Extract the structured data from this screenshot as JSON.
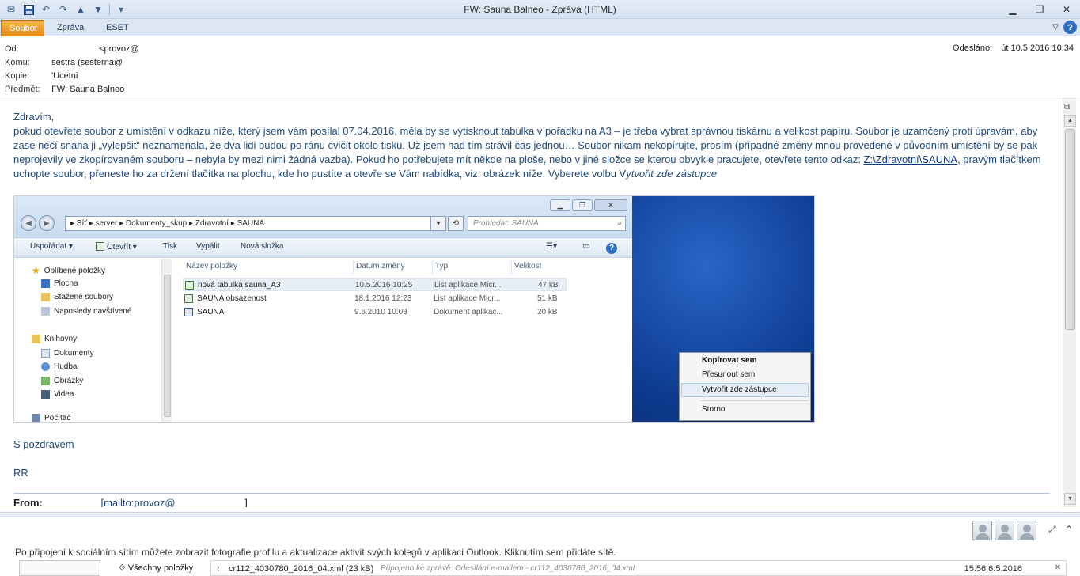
{
  "window": {
    "title": "FW: Sauna Balneo  -  Zpráva (HTML)",
    "controls": {
      "minimize": "▁",
      "restore": "❐",
      "close": "✕"
    }
  },
  "qat": {
    "icons": [
      "mail-icon",
      "save-icon",
      "undo-icon",
      "redo-icon",
      "up-icon",
      "down-icon",
      "customize-icon"
    ]
  },
  "ribbon": {
    "tabs": [
      {
        "label": "Soubor"
      },
      {
        "label": "Zpráva"
      },
      {
        "label": "ESET"
      }
    ],
    "help": "?",
    "collapse": "▽"
  },
  "header": {
    "from_label": "Od:",
    "from_value": "<provoz@",
    "to_label": "Komu:",
    "to_value": "sestra (sesterna@",
    "cc_label": "Kopie:",
    "cc_value": "'Ucetni",
    "subject_label": "Předmět:",
    "subject_value": "FW: Sauna Balneo",
    "sent_label": "Odesláno:",
    "sent_value": "út 10.5.2016 10:34"
  },
  "body": {
    "greeting": "Zdravím,",
    "para_part1": "pokud otevřete soubor z umístění v odkazu níže, který jsem vám posílal 07.04.2016, měla by se vytisknout tabulka v pořádku na A3 – je třeba vybrat správnou tiskárnu a velikost papíru. Soubor je uzamčený proti úpravám, aby zase něčí snaha ji „vylepšit“ neznamenala, že dva lidi budou po ránu cvičit okolo tisku. Už jsem nad tím strávil čas jednou… Soubor nikam nekopírujte, prosím (případné změny mnou provedené v původním umístění by se pak neprojevily ve zkopírovaném souboru – nebyla by mezi nimi žádná vazba). Pokud ho potřebujete mít někde na ploše, nebo v jiné složce  se kterou obvykle pracujete, otevřete tento odkaz: ",
    "link": "Z:\\Zdravotní\\SAUNA",
    "para_part2": ", pravým tlačítkem uchopte soubor, přeneste ho za držení tlačítka na plochu, kde ho pustíte a otevře se Vám nabídka, viz. obrázek níže. Vyberete volbu V",
    "para_em": "ytvořit zde zástupce",
    "regards": "S pozdravem",
    "signature": "RR",
    "fwd_from_label": "From:",
    "fwd_from_value": "[mailto:provoz@",
    "fwd_from_end": "]"
  },
  "explorer": {
    "nav_back": "◀",
    "nav_fwd": "▶",
    "path": "▸  Síť  ▸  server  ▸  Dokumenty_skup  ▸  Zdravotní  ▸  SAUNA",
    "search_placeholder": "Prohledat: SAUNA",
    "toolbar": [
      "Uspořádat ▾",
      "Otevřít ▾",
      "Tisk",
      "Vypálit",
      "Nová složka"
    ],
    "sidebar": [
      "Oblíbené položky",
      "Plocha",
      "Stažené soubory",
      "Naposledy navštívené",
      "Knihovny",
      "Dokumenty",
      "Hudba",
      "Obrázky",
      "Videa",
      "Počítač"
    ],
    "columns": [
      "Název položky",
      "Datum změny",
      "Typ",
      "Velikost"
    ],
    "files": [
      {
        "name": "nová tabulka sauna_A3",
        "date": "10.5.2016 10:25",
        "type": "List aplikace Micr...",
        "size": "47 kB"
      },
      {
        "name": "SAUNA obsazenost",
        "date": "18.1.2016 12:23",
        "type": "List aplikace Micr...",
        "size": "51 kB"
      },
      {
        "name": "SAUNA",
        "date": "9.6.2010 10:03",
        "type": "Dokument aplikac...",
        "size": "20 kB"
      }
    ],
    "context_menu": [
      "Kopírovat sem",
      "Přesunout sem",
      "Vytvořit zde zástupce",
      "Storno"
    ]
  },
  "people_pane": {
    "message": "Po připojení k sociálním sítím můžete zobrazit fotografie profilu a aktualizace aktivit svých kolegů v aplikaci Outlook. Kliknutím sem přidáte sítě.",
    "expand": "⤢",
    "collapse": "⌃"
  },
  "attachment_bar": {
    "all_items": "Všechny položky",
    "attachment_name": "cr112_4030780_2016_04.xml (23 kB)",
    "attachment_caption": "Připojeno ke zprávě: Odesílání e-mailem - cr112_4030780_2016_04.xml",
    "date": "15:56 6.5.2016"
  }
}
